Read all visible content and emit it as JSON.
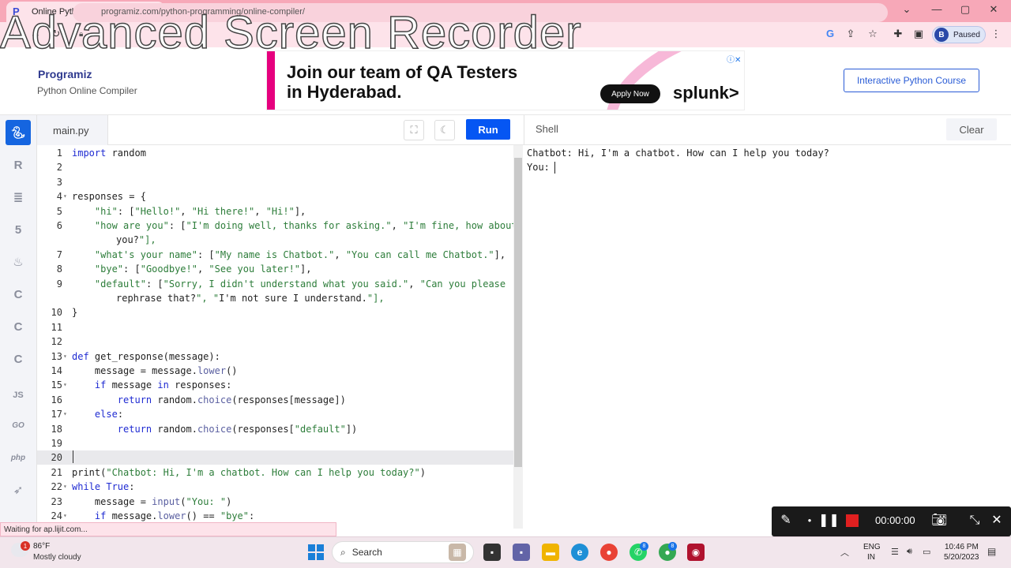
{
  "browser": {
    "tab_title": "Online Python Compiler (Interpre",
    "new_tab": "+",
    "url": "programiz.com/python-programming/online-compiler/",
    "profile_initial": "B",
    "profile_status": "Paused"
  },
  "watermark": "Advanced Screen Recorder",
  "site": {
    "logo": "Programiz",
    "logo_sub": "Python Online Compiler",
    "ad_headline_1": "Join our team of QA Testers",
    "ad_headline_2": "in Hyderabad.",
    "ad_cta": "Apply Now",
    "ad_brand": "splunk>",
    "course_button": "Interactive Python Course"
  },
  "rail_labels": {
    "js": "JS",
    "go": "GO",
    "php": "php"
  },
  "editor": {
    "file_name": "main.py",
    "run_label": "Run",
    "lines": [
      {
        "n": "1",
        "fold": "",
        "code": "import random"
      },
      {
        "n": "2",
        "fold": "",
        "code": ""
      },
      {
        "n": "3",
        "fold": "",
        "code": ""
      },
      {
        "n": "4",
        "fold": "▾",
        "code": "responses = {"
      },
      {
        "n": "5",
        "fold": "",
        "code": "    \"hi\": [\"Hello!\", \"Hi there!\", \"Hi!\"],"
      },
      {
        "n": "6",
        "fold": "",
        "code": "    \"how are you\": [\"I'm doing well, thanks for asking.\", \"I'm fine, how about"
      },
      {
        "n": "",
        "fold": "",
        "code": "you?\"],"
      },
      {
        "n": "7",
        "fold": "",
        "code": "    \"what's your name\": [\"My name is Chatbot.\", \"You can call me Chatbot.\"],"
      },
      {
        "n": "8",
        "fold": "",
        "code": "    \"bye\": [\"Goodbye!\", \"See you later!\"],"
      },
      {
        "n": "9",
        "fold": "",
        "code": "    \"default\": [\"Sorry, I didn't understand what you said.\", \"Can you please"
      },
      {
        "n": "",
        "fold": "",
        "code": "rephrase that?\", \"I'm not sure I understand.\"],"
      },
      {
        "n": "10",
        "fold": "",
        "code": "}"
      },
      {
        "n": "11",
        "fold": "",
        "code": ""
      },
      {
        "n": "12",
        "fold": "",
        "code": ""
      },
      {
        "n": "13",
        "fold": "▾",
        "code": "def get_response(message):"
      },
      {
        "n": "14",
        "fold": "",
        "code": "    message = message.lower()"
      },
      {
        "n": "15",
        "fold": "▾",
        "code": "    if message in responses:"
      },
      {
        "n": "16",
        "fold": "",
        "code": "        return random.choice(responses[message])"
      },
      {
        "n": "17",
        "fold": "▾",
        "code": "    else:"
      },
      {
        "n": "18",
        "fold": "",
        "code": "        return random.choice(responses[\"default\"])"
      },
      {
        "n": "19",
        "fold": "",
        "code": ""
      },
      {
        "n": "20",
        "fold": "",
        "code": ""
      },
      {
        "n": "21",
        "fold": "",
        "code": "print(\"Chatbot: Hi, I'm a chatbot. How can I help you today?\")"
      },
      {
        "n": "22",
        "fold": "▾",
        "code": "while True:"
      },
      {
        "n": "23",
        "fold": "",
        "code": "    message = input(\"You: \")"
      },
      {
        "n": "24",
        "fold": "▾",
        "code": "    if message.lower() == \"bye\":"
      }
    ]
  },
  "shell": {
    "title": "Shell",
    "clear_label": "Clear",
    "output_line_1": "Chatbot: Hi, I'm a chatbot. How can I help you today?",
    "output_line_2": "You: "
  },
  "status_text": "Waiting for ap.lijit.com...",
  "recorder": {
    "time": "00:00:00"
  },
  "taskbar": {
    "weather_badge": "1",
    "temperature": "86°F",
    "weather": "Mostly cloudy",
    "search_label": "Search",
    "badge_whatsapp": "8",
    "badge_chrome": "8",
    "lang_1": "ENG",
    "lang_2": "IN",
    "time": "10:46 PM",
    "date": "5/20/2023"
  },
  "colors": {
    "accent": "#0556f3",
    "chrome_pink": "#f7a8b8",
    "keyword": "#1f2bd2",
    "string": "#2d7d3a"
  }
}
